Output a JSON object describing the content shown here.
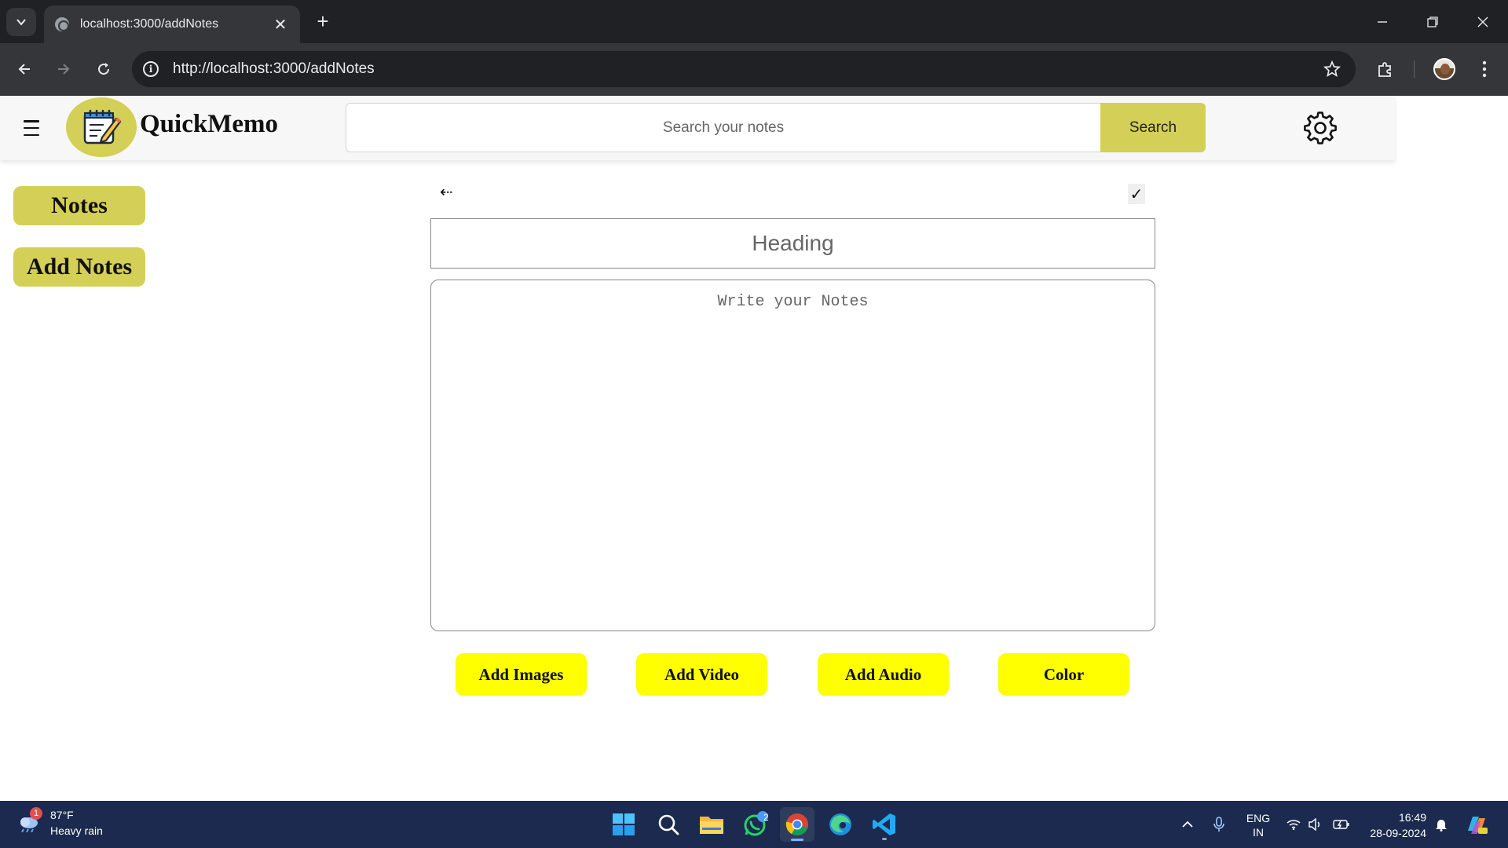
{
  "browser": {
    "tab_title": "localhost:3000/addNotes",
    "tab_close": "✕",
    "new_tab": "+",
    "url": "http://localhost:3000/addNotes",
    "info_glyph": "i"
  },
  "app": {
    "brand": "QuickMemo",
    "search": {
      "placeholder": "Search your notes",
      "button_label": "Search"
    },
    "sidebar": {
      "items": [
        {
          "label": "Notes"
        },
        {
          "label": "Add Notes"
        }
      ]
    },
    "editor": {
      "back_glyph": "⇠",
      "save_glyph": "✓",
      "heading_placeholder": "Heading",
      "body_placeholder": "Write your Notes"
    },
    "actions": [
      {
        "label": "Add Images"
      },
      {
        "label": "Add Video"
      },
      {
        "label": "Add Audio"
      },
      {
        "label": "Color"
      }
    ],
    "colors": {
      "accent": "#d4cf56",
      "action_yellow": "#ffff00"
    }
  },
  "taskbar": {
    "weather": {
      "badge": "1",
      "temp": "87°F",
      "desc": "Heavy rain"
    },
    "whatsapp_badge": "2",
    "language": {
      "line1": "ENG",
      "line2": "IN"
    },
    "clock": {
      "time": "16:49",
      "date": "28-09-2024"
    },
    "icons": [
      "start-icon",
      "search-icon",
      "file-explorer-icon",
      "whatsapp-icon",
      "chrome-icon",
      "edge-icon",
      "vscode-icon"
    ]
  }
}
